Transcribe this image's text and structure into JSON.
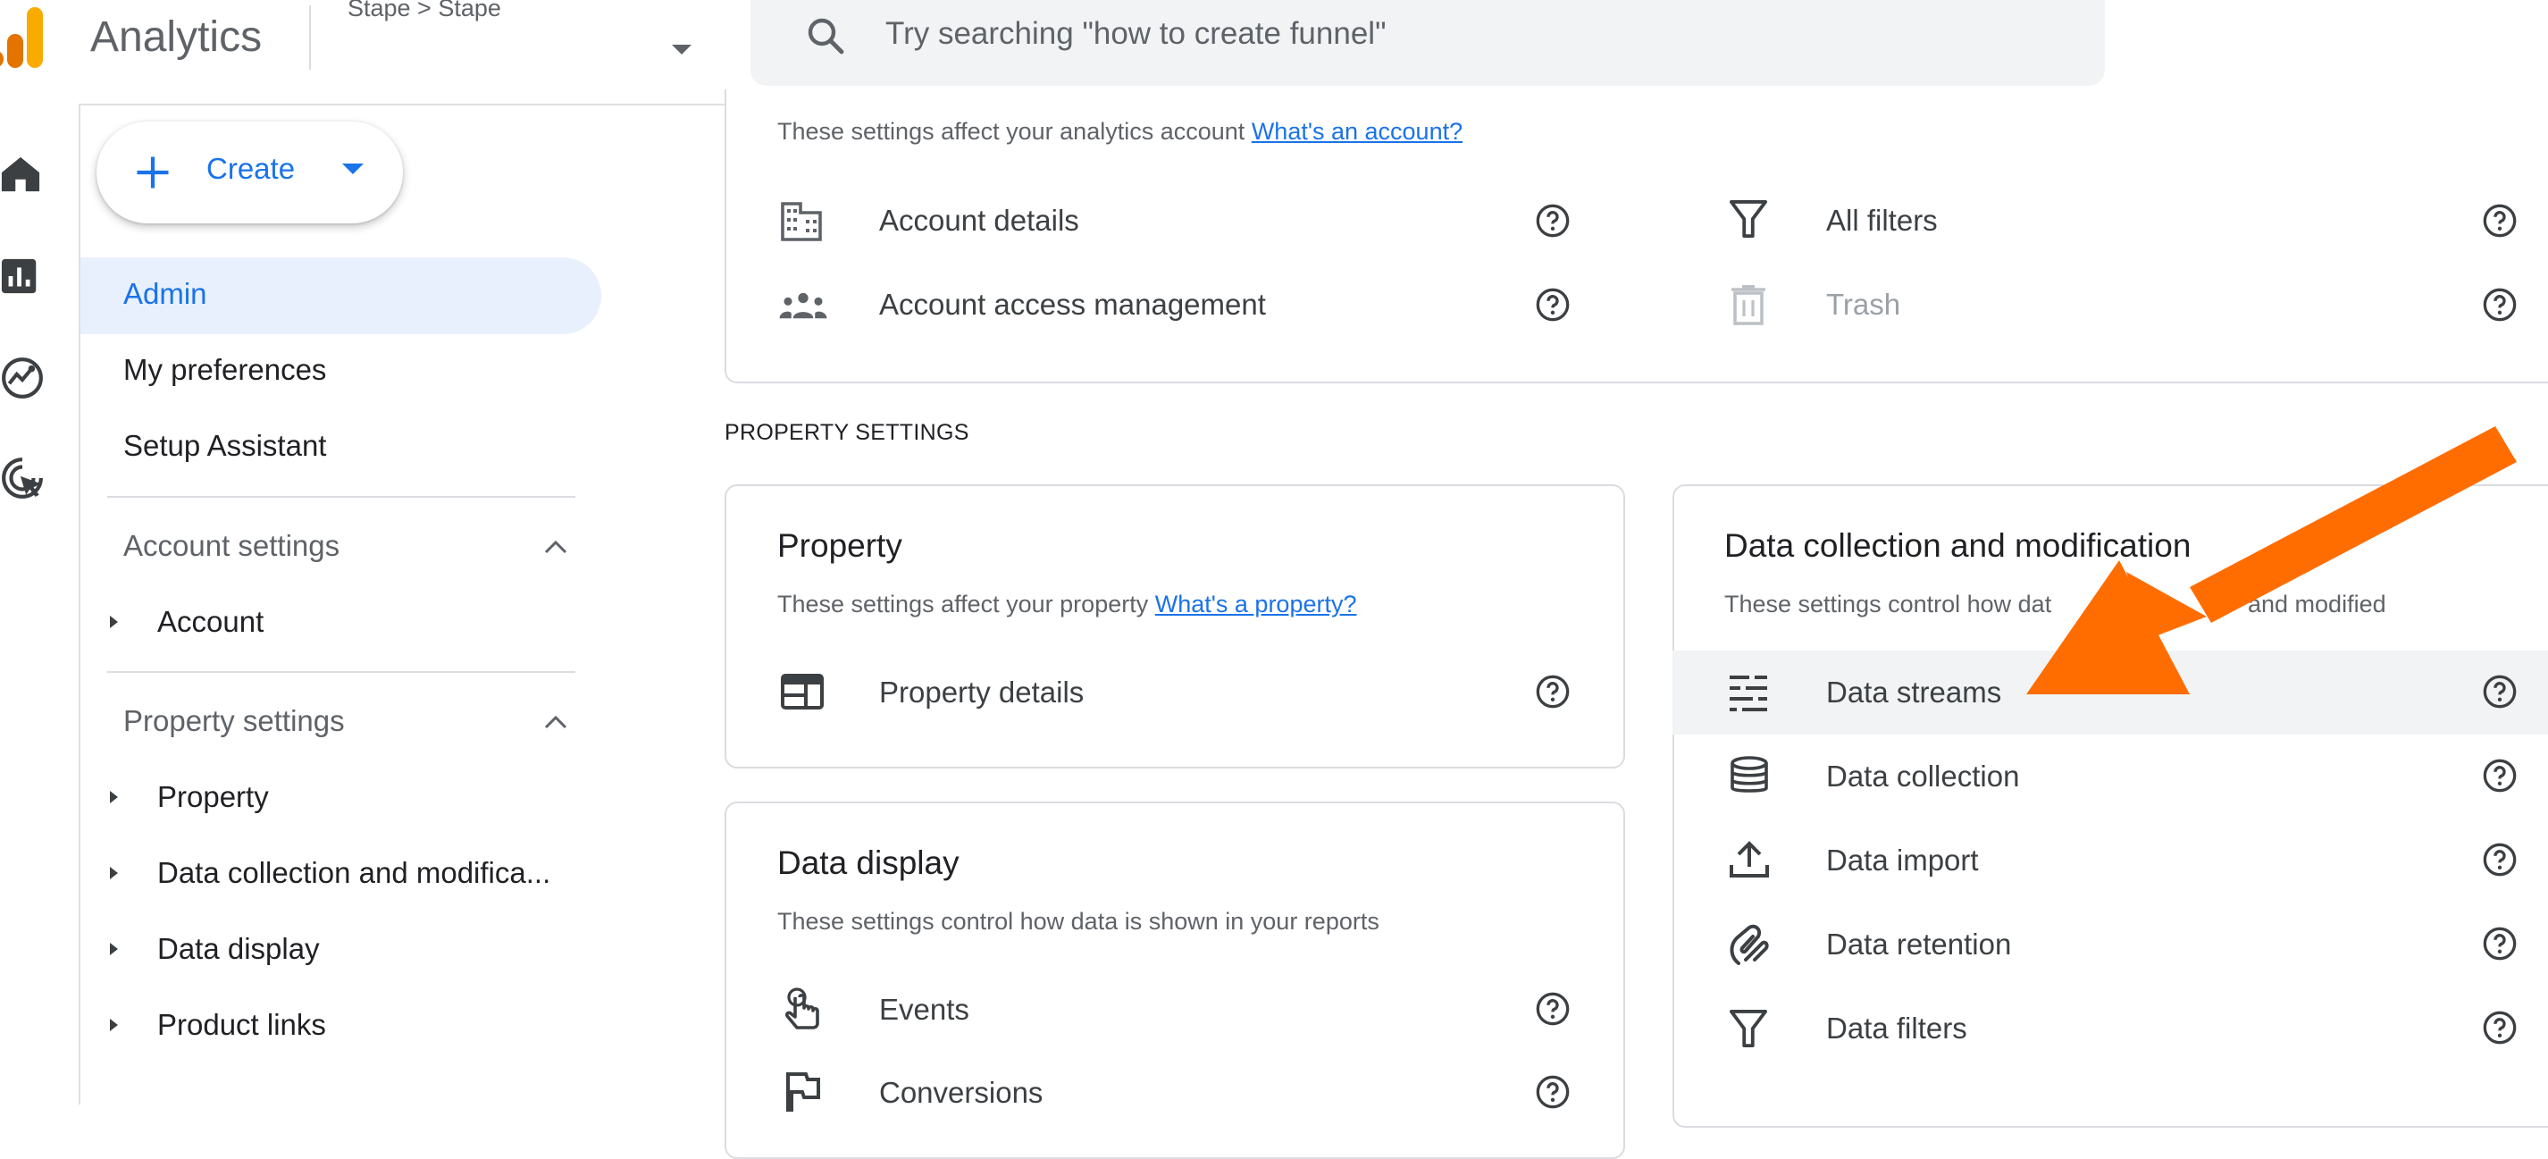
{
  "header": {
    "app_title": "Analytics",
    "breadcrumb": "Stape > Stape",
    "search": {
      "placeholder": "Try searching \"how to create funnel\""
    }
  },
  "rail": {
    "icons": [
      "home-icon",
      "reports-icon",
      "explore-icon",
      "advertising-icon"
    ]
  },
  "sidebar": {
    "create_label": "Create",
    "items": [
      {
        "label": "Admin",
        "selected": true
      },
      {
        "label": "My preferences"
      },
      {
        "label": "Setup Assistant"
      }
    ],
    "account_section": {
      "title": "Account settings",
      "items": [
        {
          "label": "Account"
        }
      ]
    },
    "property_section": {
      "title": "Property settings",
      "items": [
        {
          "label": "Property"
        },
        {
          "label": "Data collection and modifica..."
        },
        {
          "label": "Data display"
        },
        {
          "label": "Product links"
        }
      ]
    }
  },
  "account_card": {
    "description": "These settings affect your analytics account",
    "link": "What's an account?",
    "rows_left": [
      {
        "label": "Account details",
        "icon": "building-icon"
      },
      {
        "label": "Account access management",
        "icon": "people-icon"
      }
    ],
    "rows_right": [
      {
        "label": "All filters",
        "icon": "filter-icon"
      },
      {
        "label": "Trash",
        "icon": "trash-icon",
        "disabled": true
      }
    ]
  },
  "property_settings_heading": "PROPERTY SETTINGS",
  "property_card": {
    "title": "Property",
    "description": "These settings affect your property",
    "link": "What's a property?",
    "rows": [
      {
        "label": "Property details",
        "icon": "property-details-icon"
      }
    ]
  },
  "data_display_card": {
    "title": "Data display",
    "description": "These settings control how data is shown in your reports",
    "rows": [
      {
        "label": "Events",
        "icon": "touch-icon"
      },
      {
        "label": "Conversions",
        "icon": "flag-icon"
      }
    ]
  },
  "data_collection_card": {
    "title": "Data collection and modification",
    "description_start": "These settings control how dat",
    "description_end": "and modified",
    "rows": [
      {
        "label": "Data streams",
        "icon": "data-streams-icon",
        "highlighted": true
      },
      {
        "label": "Data collection",
        "icon": "database-icon"
      },
      {
        "label": "Data import",
        "icon": "upload-icon"
      },
      {
        "label": "Data retention",
        "icon": "retention-icon"
      },
      {
        "label": "Data filters",
        "icon": "filter-icon"
      }
    ]
  },
  "colors": {
    "accent": "#1a73e8",
    "selected_bg": "#e8f0fe",
    "arrow": "#ff6d00",
    "logo_orange": "#f9ab00",
    "logo_dark_orange": "#e37400"
  }
}
